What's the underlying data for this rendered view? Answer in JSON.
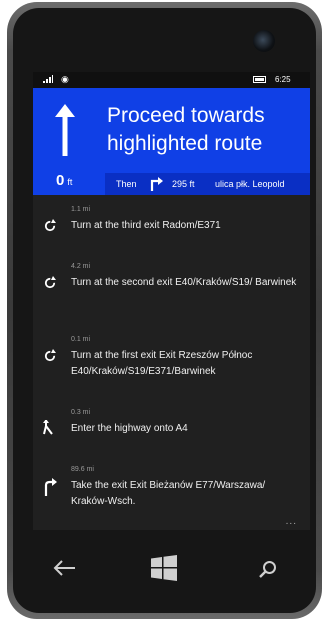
{
  "status": {
    "time": "6:25"
  },
  "banner": {
    "instruction": "Proceed towards highlighted route",
    "distance_value": "0",
    "distance_unit": "ft",
    "then_label": "Then",
    "then_distance": "295 ft",
    "then_street": "ulica płk. Leopold"
  },
  "steps": [
    {
      "distance": "1.1 mi",
      "text": "Turn at the third exit Radom/E371",
      "icon": "roundabout-icon"
    },
    {
      "distance": "4.2 mi",
      "text": "Turn at the second exit E40/Kraków/S19/ Barwinek",
      "icon": "roundabout-icon"
    },
    {
      "distance": "0.1 mi",
      "text": "Turn at the first exit Exit Rzeszów Północ E40/Kraków/S19/E371/Barwinek",
      "icon": "roundabout-icon"
    },
    {
      "distance": "0.3 mi",
      "text": "Enter the highway onto A4",
      "icon": "merge-icon"
    },
    {
      "distance": "89.6 mi",
      "text": "Take the exit Exit Bieżanów E77/Warszawa/ Kraków-Wsch.",
      "icon": "exit-right-icon"
    }
  ],
  "more_label": "...",
  "colors": {
    "banner": "#1040e6",
    "screen": "#202020"
  }
}
